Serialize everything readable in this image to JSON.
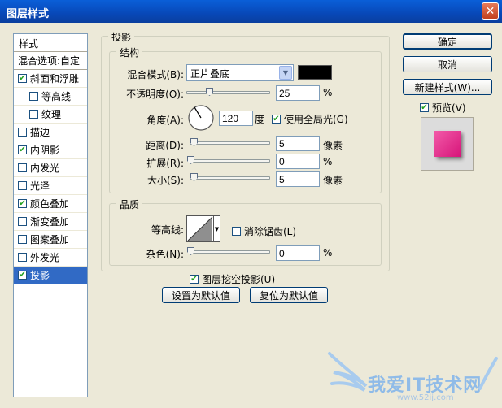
{
  "window": {
    "title": "图层样式",
    "close_glyph": "✕"
  },
  "styles_panel": {
    "header": "样式",
    "blend_options": "混合选项:自定",
    "items": [
      {
        "label": "斜面和浮雕",
        "checked": true
      },
      {
        "label": "等高线",
        "checked": false
      },
      {
        "label": "纹理",
        "checked": false
      },
      {
        "label": "描边",
        "checked": false
      },
      {
        "label": "内阴影",
        "checked": true
      },
      {
        "label": "内发光",
        "checked": false
      },
      {
        "label": "光泽",
        "checked": false
      },
      {
        "label": "颜色叠加",
        "checked": true
      },
      {
        "label": "渐变叠加",
        "checked": false
      },
      {
        "label": "图案叠加",
        "checked": false
      },
      {
        "label": "外发光",
        "checked": false
      },
      {
        "label": "投影",
        "checked": true
      }
    ]
  },
  "drop_shadow": {
    "title": "投影",
    "structure": {
      "title": "结构",
      "blend_mode_label": "混合模式(B):",
      "blend_mode_value": "正片叠底",
      "blend_color": "#000000",
      "opacity_label": "不透明度(O):",
      "opacity_value": "25",
      "opacity_unit": "%",
      "angle_label": "角度(A):",
      "angle_value": "120",
      "angle_unit": "度",
      "global_light_label": "使用全局光(G)",
      "distance_label": "距离(D):",
      "distance_value": "5",
      "distance_unit": "像素",
      "spread_label": "扩展(R):",
      "spread_value": "0",
      "spread_unit": "%",
      "size_label": "大小(S):",
      "size_value": "5",
      "size_unit": "像素"
    },
    "quality": {
      "title": "品质",
      "contour_label": "等高线:",
      "anti_alias_label": "消除锯齿(L)",
      "noise_label": "杂色(N):",
      "noise_value": "0",
      "noise_unit": "%"
    },
    "knockout_label": "图层挖空投影(U)",
    "make_default": "设置为默认值",
    "reset_default": "复位为默认值"
  },
  "buttons": {
    "ok": "确定",
    "cancel": "取消",
    "new_style": "新建样式(W)...",
    "preview_label": "预览(V)"
  },
  "watermark": {
    "text": "我爱IT技术网",
    "url": "www.52ij.com"
  },
  "colors": {
    "selection": "#316ac5",
    "title_bar": "#0848b8",
    "preview_swatch": "#e8338f"
  }
}
